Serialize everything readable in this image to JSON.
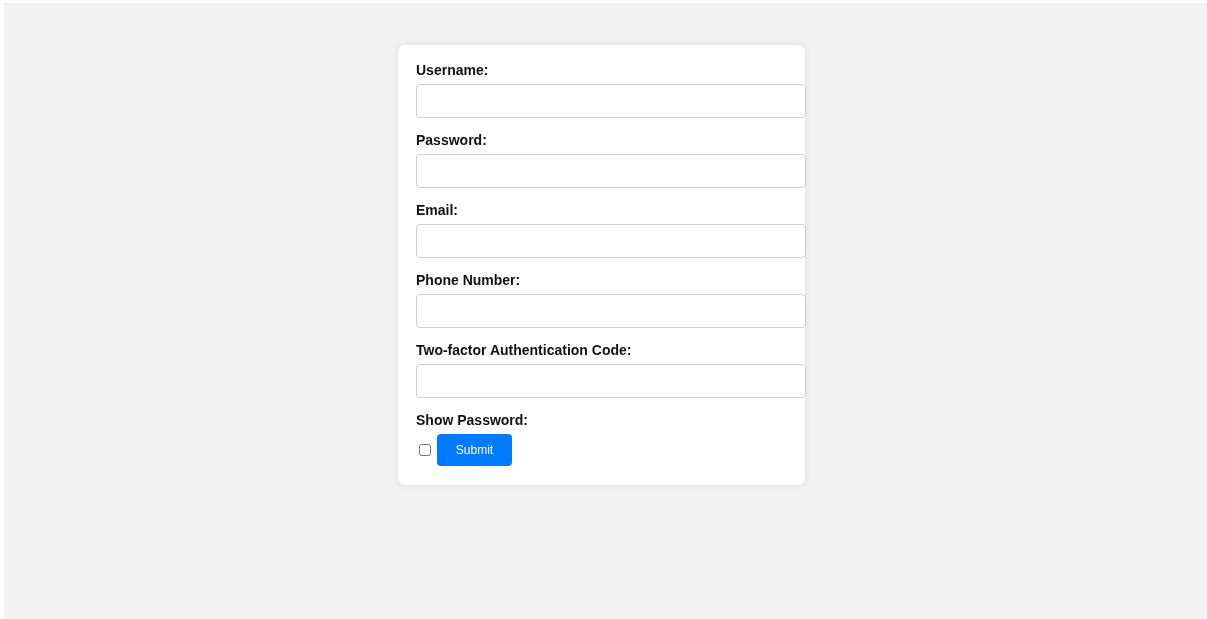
{
  "fields": [
    {
      "label": "Username:"
    },
    {
      "label": "Password:"
    },
    {
      "label": "Email:"
    },
    {
      "label": "Phone Number:"
    },
    {
      "label": "Two-factor Authentication Code:"
    }
  ],
  "show_password": {
    "label": "Show Password:",
    "checked": false
  },
  "submit": {
    "label": "Submit"
  }
}
